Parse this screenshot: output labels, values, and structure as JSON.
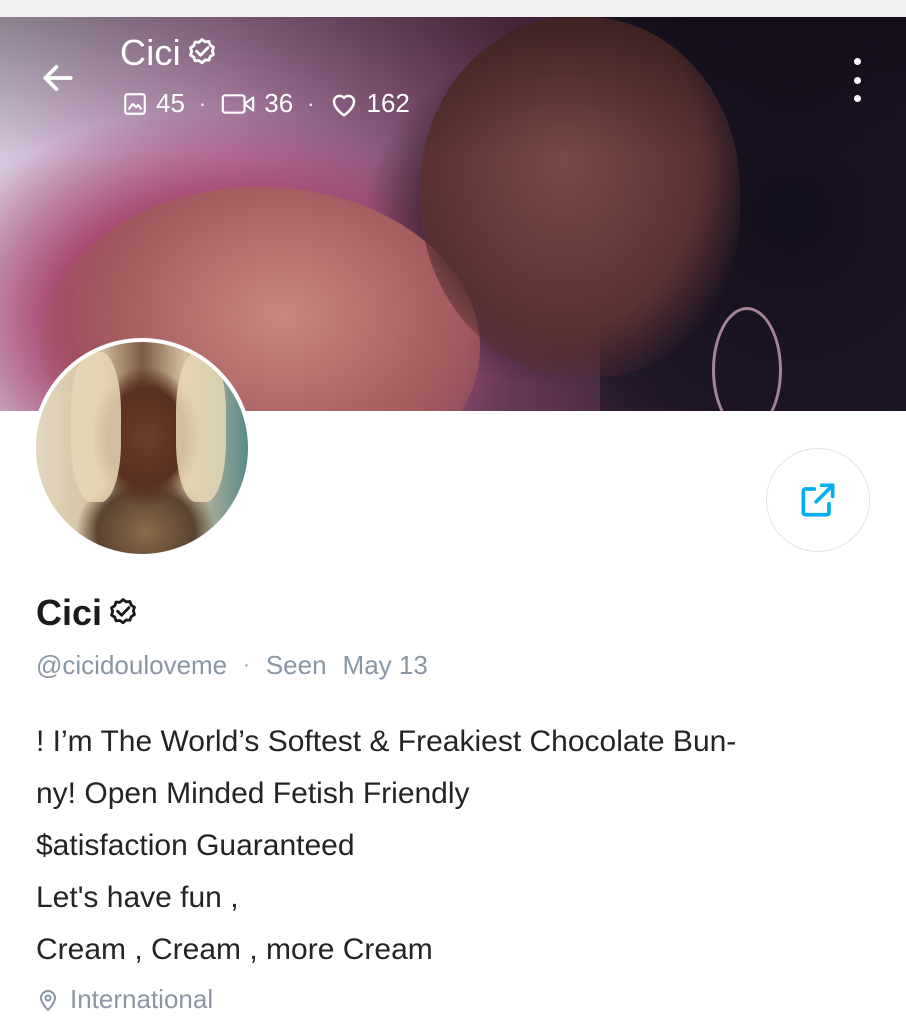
{
  "header": {
    "name": "Cici",
    "stats": {
      "photos": "45",
      "videos": "36",
      "likes": "162"
    },
    "separator": "·"
  },
  "profile": {
    "name": "Cici",
    "handle": "@cicidouloveme",
    "separator": "·",
    "seen_label": "Seen",
    "seen_date": "May 13",
    "bio_lines": [
      "! I’m The World’s Softest & Freakiest Chocolate Bun-",
      "ny! Open Minded Fetish Friendly",
      "$atisfaction Guaranteed",
      "Let's have fun ,",
      "Cream , Cream , more Cream"
    ],
    "location": "International"
  },
  "colors": {
    "accent": "#00aff0",
    "muted_text": "#8a96a3",
    "body_text": "#242424"
  },
  "icons": [
    "back-arrow-icon",
    "verified-badge-icon",
    "image-icon",
    "video-icon",
    "heart-icon",
    "more-vertical-icon",
    "share-icon",
    "location-pin-icon"
  ]
}
